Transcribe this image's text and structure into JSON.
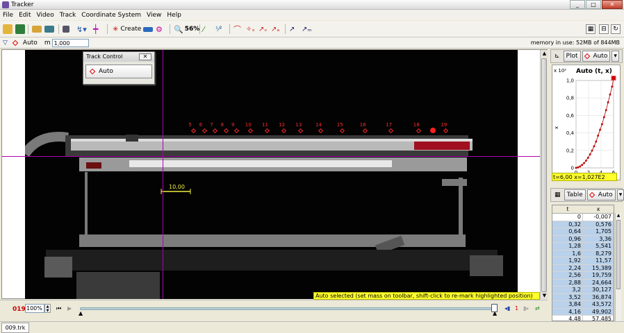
{
  "window": {
    "title": "Tracker",
    "min": "_",
    "max": "□",
    "close": "✕"
  },
  "menu": [
    "File",
    "Edit",
    "Video",
    "Track",
    "Coordinate System",
    "View",
    "Help"
  ],
  "toolbar": {
    "create_label": "Create",
    "zoom_label": "56%"
  },
  "track_bar": {
    "name": "Auto",
    "mass_label": "m",
    "mass_value": "1,000",
    "memory": "memory in use: 52MB of 844MB"
  },
  "track_control": {
    "title": "Track Control",
    "close": "✕",
    "button": "Auto"
  },
  "video": {
    "markers": [
      {
        "label": "5",
        "v": 0.35
      },
      {
        "label": "6",
        "v": 0.7
      },
      {
        "label": "7",
        "v": 1.05
      },
      {
        "label": "8",
        "v": 1.4
      },
      {
        "label": "9",
        "v": 1.75
      },
      {
        "label": "10",
        "v": 2.2
      },
      {
        "label": "11",
        "v": 2.75
      },
      {
        "label": "12",
        "v": 3.3
      },
      {
        "label": "13",
        "v": 3.85
      },
      {
        "label": "14",
        "v": 4.5
      },
      {
        "label": "15",
        "v": 5.2
      },
      {
        "label": "16",
        "v": 5.95
      },
      {
        "label": "17",
        "v": 6.8
      },
      {
        "label": "18",
        "v": 7.7
      },
      {
        "label": "19",
        "v": 8.6
      }
    ],
    "calibration_label": "10,00",
    "status": "Auto selected (set mass on toolbar, shift-click to re-mark highlighted position)"
  },
  "player": {
    "frame": "019",
    "zoom": "100%",
    "step": "1"
  },
  "plot": {
    "tab_label": "Plot",
    "track": "Auto",
    "exponent_label": "x 10²",
    "readout": "t=6,00  x=1,027E2",
    "chart_data": {
      "type": "scatter",
      "title": "Auto (t, x)",
      "xlabel": "t",
      "ylabel": "x",
      "xlim": [
        0,
        6
      ],
      "ylim": [
        0,
        1.0
      ],
      "xticks": [
        "0",
        "2",
        "4",
        "6"
      ],
      "yticks": [
        "0",
        "0,2",
        "0,4",
        "0,6",
        "0,8",
        "1,0"
      ],
      "x": [
        0,
        0.32,
        0.64,
        0.96,
        1.28,
        1.6,
        1.92,
        2.24,
        2.56,
        2.88,
        3.2,
        3.52,
        3.84,
        4.16,
        4.48,
        4.8,
        5.12,
        5.44,
        5.76,
        6.0
      ],
      "y": [
        0,
        0.006,
        0.017,
        0.034,
        0.055,
        0.083,
        0.116,
        0.154,
        0.198,
        0.247,
        0.301,
        0.369,
        0.436,
        0.499,
        0.58,
        0.66,
        0.75,
        0.84,
        0.93,
        1.027
      ]
    }
  },
  "table": {
    "tab_label": "Table",
    "track": "Auto",
    "headers": [
      "t",
      "x"
    ],
    "rows": [
      [
        "0",
        "-0,007"
      ],
      [
        "0,32",
        "0,576"
      ],
      [
        "0,64",
        "1,705"
      ],
      [
        "0,96",
        "3,36"
      ],
      [
        "1,28",
        "5,541"
      ],
      [
        "1,6",
        "8,279"
      ],
      [
        "1,92",
        "11,57"
      ],
      [
        "2,24",
        "15,389"
      ],
      [
        "2,56",
        "19,759"
      ],
      [
        "2,88",
        "24,664"
      ],
      [
        "3,2",
        "30,127"
      ],
      [
        "3,52",
        "36,874"
      ],
      [
        "3,84",
        "43,572"
      ],
      [
        "4,16",
        "49,902"
      ],
      [
        "4,48",
        "57,485"
      ]
    ]
  },
  "file_tab": "009.trk"
}
